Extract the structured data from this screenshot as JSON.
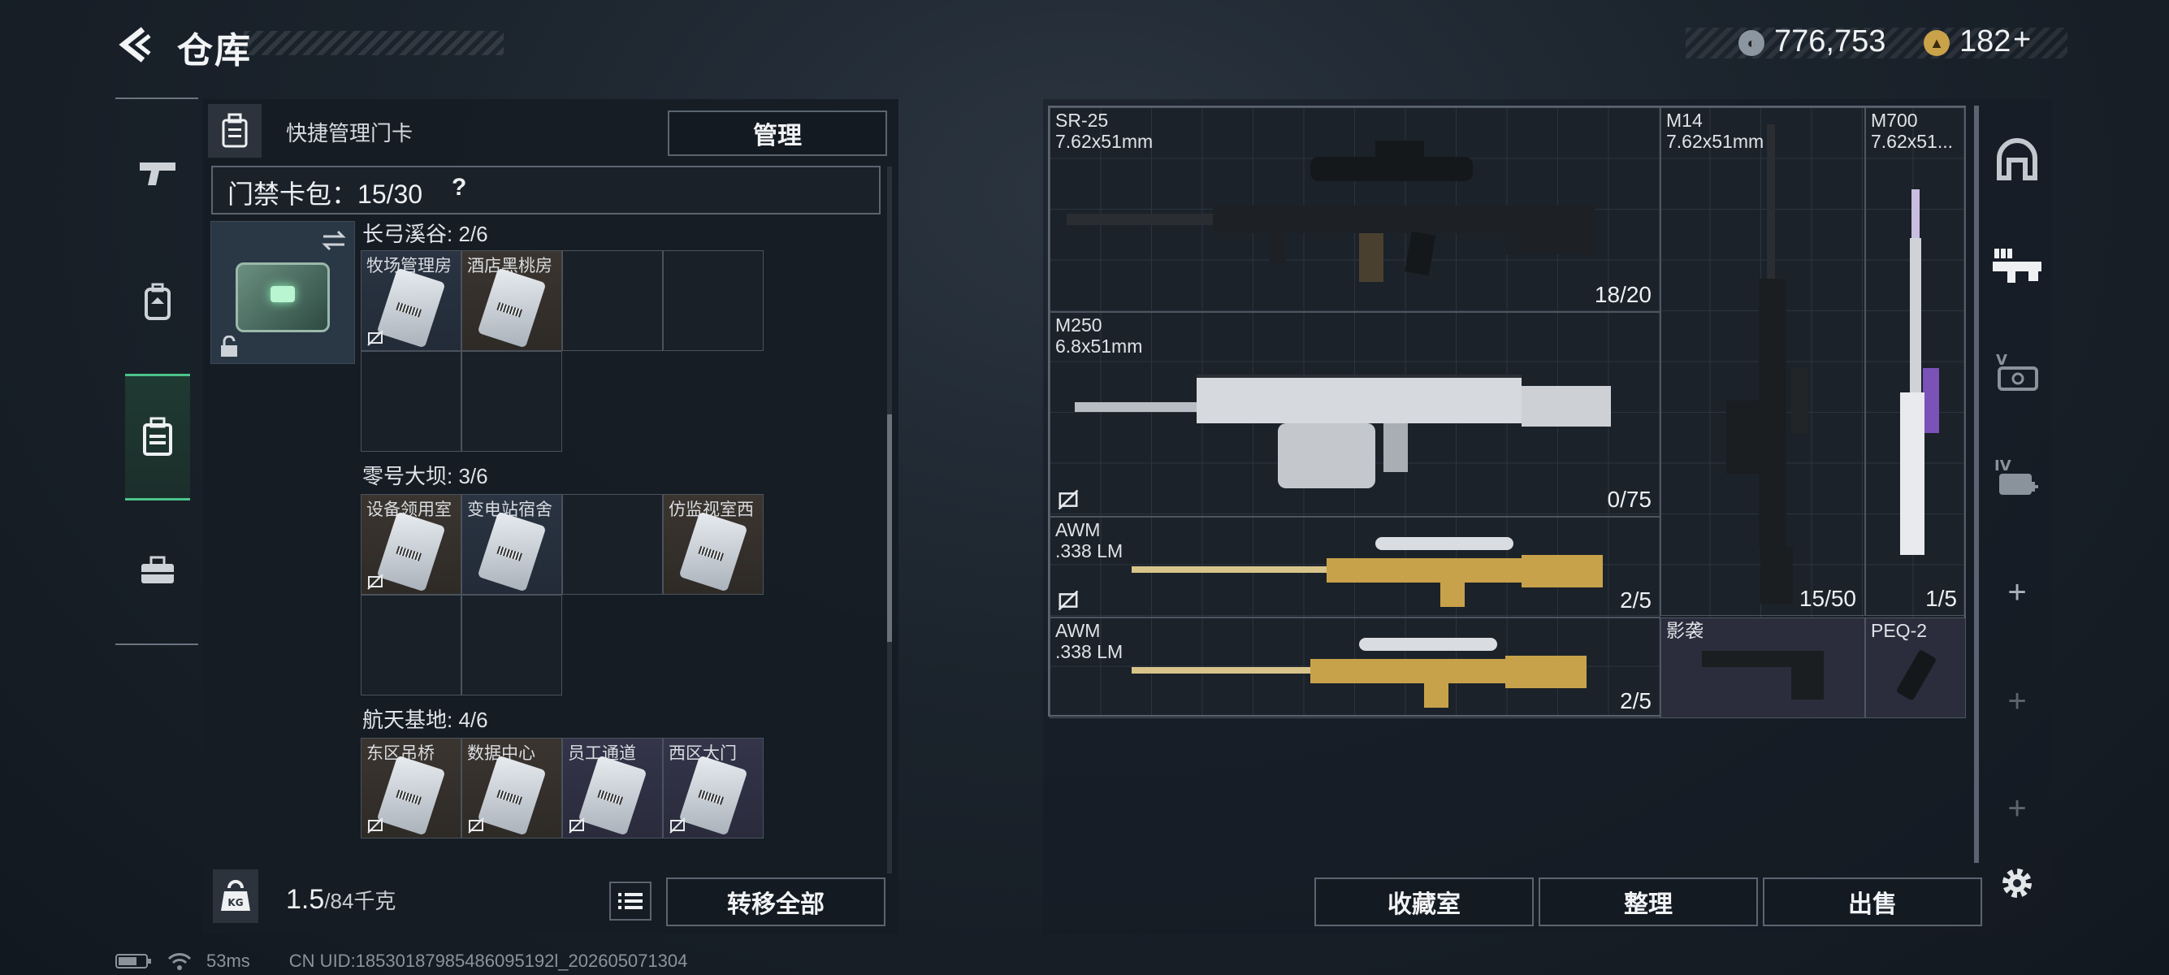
{
  "header": {
    "title": "仓库",
    "currency_primary": "776,753",
    "currency_secondary": "182",
    "currency_plus": "+"
  },
  "nav": {
    "items": [
      {
        "name": "weapons",
        "active": false
      },
      {
        "name": "backpack",
        "active": false
      },
      {
        "name": "keycard-case",
        "active": true
      },
      {
        "name": "toolbox",
        "active": false
      }
    ]
  },
  "left": {
    "quick_manage_label": "快捷管理门卡",
    "manage_button": "管理",
    "card_bag_label": "门禁卡包：",
    "card_bag_count": "15/30",
    "help": "?",
    "sections": [
      {
        "title": "长弓溪谷: 2/6",
        "cards": [
          {
            "label": "牧场管理房",
            "tone": "blue"
          },
          {
            "label": "酒店黑桃房",
            "tone": "brown"
          }
        ]
      },
      {
        "title": "零号大坝: 3/6",
        "cards": [
          {
            "label": "设备领用室",
            "tone": "brown"
          },
          {
            "label": "变电站宿舍",
            "tone": "blue"
          },
          {
            "label": "仿监视室西",
            "tone": "brown"
          }
        ]
      },
      {
        "title": "航天基地: 4/6",
        "cards": [
          {
            "label": "东区吊桥",
            "tone": "brown"
          },
          {
            "label": "数据中心",
            "tone": "brown"
          },
          {
            "label": "员工通道",
            "tone": "purple"
          },
          {
            "label": "西区大门",
            "tone": "purple"
          }
        ]
      }
    ],
    "weight_value": "1.5",
    "weight_cap": "/84千克",
    "transfer_all": "转移全部"
  },
  "right": {
    "items": [
      {
        "name": "SR-25",
        "caliber": "7.62x51mm",
        "count": "18/20"
      },
      {
        "name": "M14",
        "caliber": "7.62x51mm",
        "count": "15/50"
      },
      {
        "name": "M700",
        "caliber": "7.62x51...",
        "count": "1/5"
      },
      {
        "name": "M250",
        "caliber": "6.8x51mm",
        "count": "0/75"
      },
      {
        "name": "AWM",
        "caliber": ".338 LM",
        "count": "2/5"
      },
      {
        "name": "AWM",
        "caliber": ".338 LM",
        "count": "2/5"
      },
      {
        "name": "影袭",
        "caliber": "",
        "count": ""
      },
      {
        "name": "PEQ-2",
        "caliber": "",
        "count": ""
      }
    ],
    "btn_collection": "收藏室",
    "btn_sort": "整理",
    "btn_sell": "出售"
  },
  "status": {
    "ping": "53ms",
    "uid": "CN UID:18530187985486095192l_202605071304"
  },
  "colors": {
    "accent": "#4cc38a",
    "panel": "#161c24"
  }
}
